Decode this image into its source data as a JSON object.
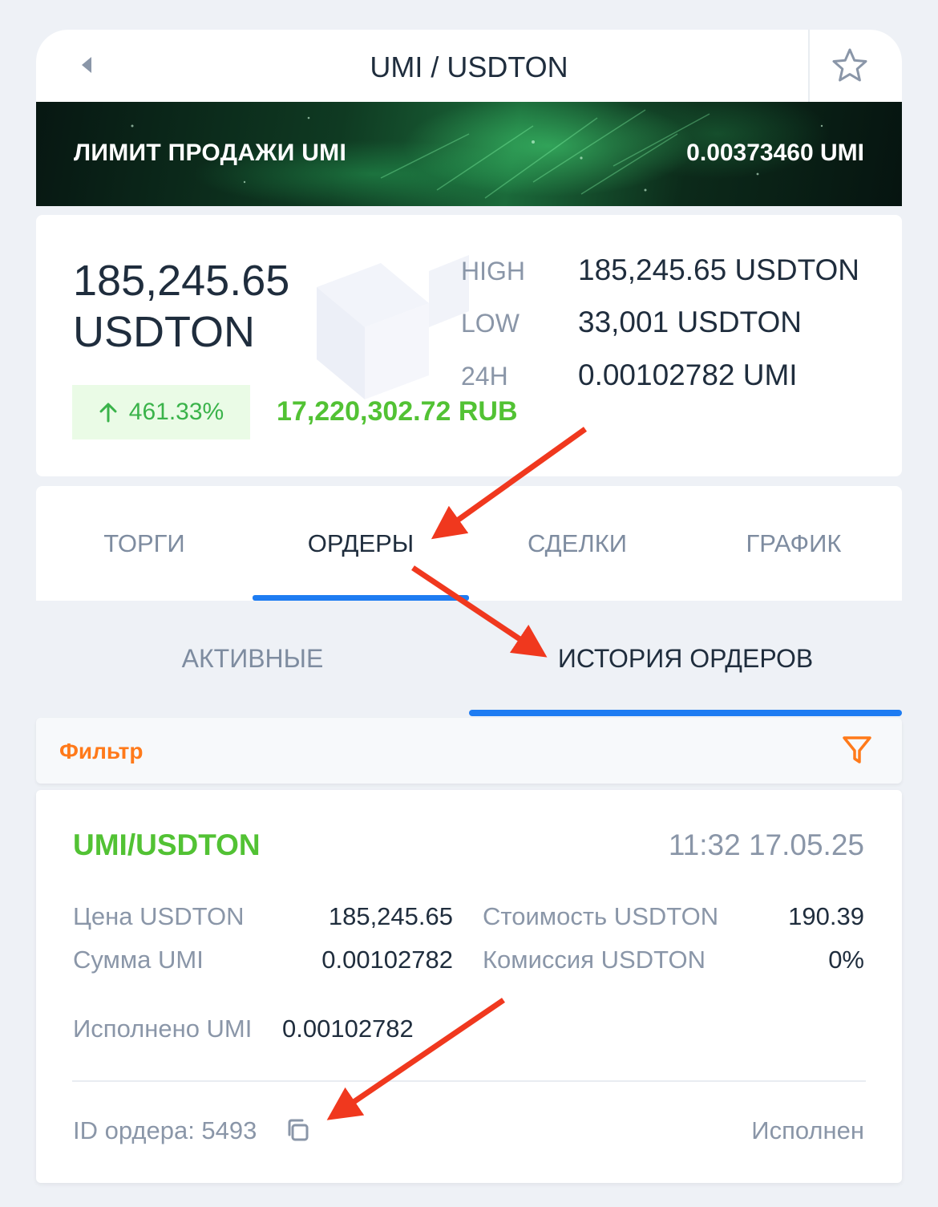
{
  "header": {
    "title": "UMI / USDTON",
    "back_icon": "back-arrow-icon",
    "favorite_icon": "star-icon"
  },
  "banner": {
    "left_text": "ЛИМИТ ПРОДАЖИ UMI",
    "right_text": "0.00373460 UMI"
  },
  "stats": {
    "price_line1": "185,245.65",
    "price_line2": "USDTON",
    "change": "461.33%",
    "change_icon": "arrow-up-icon",
    "rub_value": "17,220,302.72 RUB",
    "high_label": "HIGH",
    "high_value": "185,245.65 USDTON",
    "low_label": "LOW",
    "low_value": "33,001 USDTON",
    "h24_label": "24H",
    "h24_value": "0.00102782 UMI"
  },
  "tabs": [
    "ТОРГИ",
    "ОРДЕРЫ",
    "СДЕЛКИ",
    "ГРАФИК"
  ],
  "active_tab": "ОРДЕРЫ",
  "subtabs": [
    "АКТИВНЫЕ",
    "ИСТОРИЯ ОРДЕРОВ"
  ],
  "active_subtab": "ИСТОРИЯ ОРДЕРОВ",
  "filter": {
    "label": "Фильтр",
    "icon": "funnel-icon"
  },
  "order": {
    "pair": "UMI/USDTON",
    "time": "11:32 17.05.25",
    "price_label": "Цена USDTON",
    "price_value": "185,245.65",
    "cost_label": "Стоимость USDTON",
    "cost_value": "190.39",
    "amount_label": "Сумма UMI",
    "amount_value": "0.00102782",
    "fee_label": "Комиссия USDTON",
    "fee_value": "0%",
    "filled_label": "Исполнено UMI",
    "filled_value": "0.00102782",
    "id_text": "ID ордера: 5493",
    "copy_icon": "copy-icon",
    "status": "Исполнен"
  },
  "colors": {
    "accent_blue": "#1e7cf2",
    "green": "#52c234",
    "orange": "#ff7a1a",
    "annotation_red": "#f0381e"
  }
}
